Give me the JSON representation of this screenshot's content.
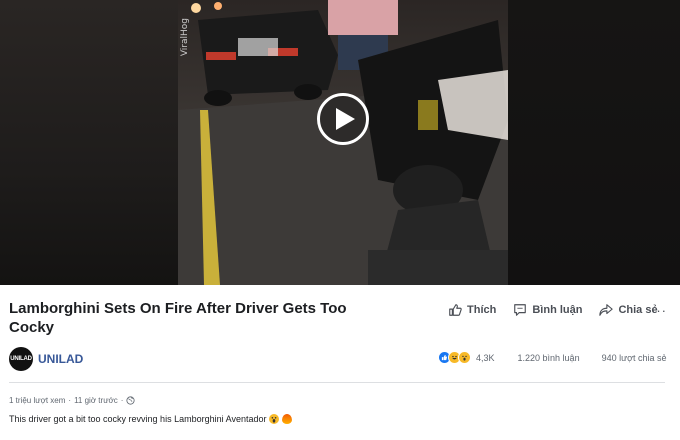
{
  "video": {
    "watermark": "ViralHog"
  },
  "post": {
    "title": "Lamborghini Sets On Fire After Driver Gets Too Cocky",
    "page_name": "UNILAD",
    "avatar_text": "UNILAD",
    "meta": {
      "views": "1 triệu lượt xem",
      "time": "11 giờ trước",
      "separator": "·"
    },
    "description": "This driver got a bit too cocky revving his Lamborghini Aventador"
  },
  "actions": {
    "like": "Thích",
    "comment": "Bình luận",
    "share": "Chia sẻ",
    "more": "···"
  },
  "stats": {
    "reactions": "4,3K",
    "comments": "1.220 bình luận",
    "shares": "940 lượt chia sẻ"
  },
  "colors": {
    "link": "#385898",
    "like_blue": "#1877f2",
    "emoji_yellow": "#f7b928",
    "fire": "#f25c05"
  },
  "icons": [
    "play-icon",
    "like-icon",
    "comment-icon",
    "share-icon",
    "globe-icon",
    "scream-emoji-icon",
    "fire-emoji-icon"
  ]
}
